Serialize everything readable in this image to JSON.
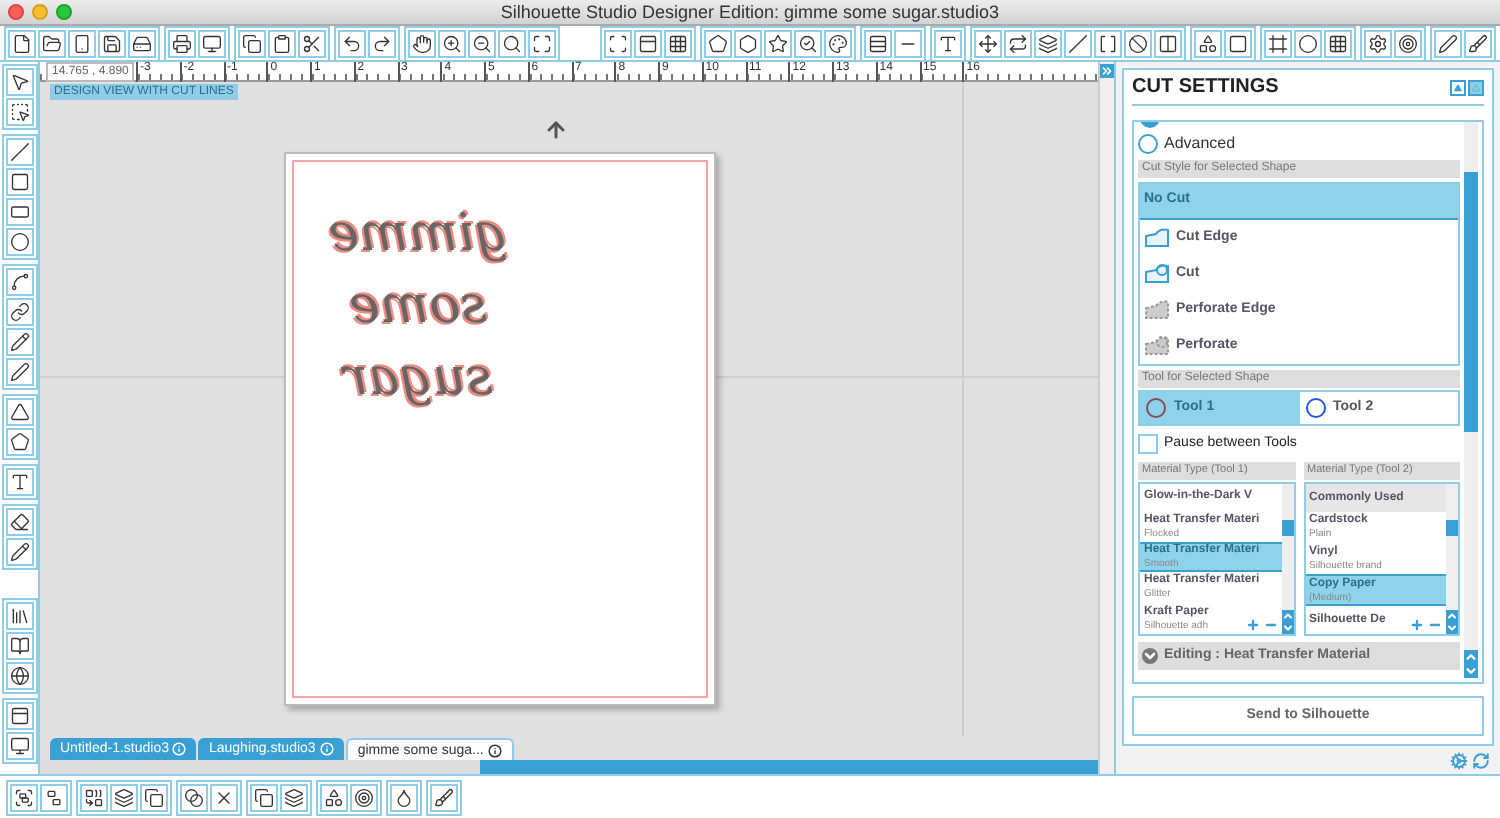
{
  "window": {
    "title": "Silhouette Studio Designer Edition: gimme some sugar.studio3"
  },
  "ruler": {
    "coordinates": "14.765 , 4.890",
    "labels": [
      "-3",
      "-2",
      "-1",
      "0",
      "1",
      "2",
      "3",
      "4",
      "5",
      "6",
      "7",
      "8",
      "9",
      "10",
      "11",
      "12",
      "13",
      "14",
      "15",
      "16"
    ]
  },
  "canvas": {
    "view_label": "DESIGN VIEW WITH CUT LINES",
    "design_text": "gimme some sugar"
  },
  "tabs": [
    {
      "label": "Untitled-1.studio3",
      "selected": false
    },
    {
      "label": "Laughing.studio3",
      "selected": false
    },
    {
      "label": "gimme some suga...",
      "selected": true
    }
  ],
  "cut_settings": {
    "title": "CUT SETTINGS",
    "mode": {
      "label": "Advanced",
      "selected": false
    },
    "cut_style_heading": "Cut Style for Selected Shape",
    "cut_styles": [
      {
        "label": "No Cut",
        "kind": "none",
        "selected": true
      },
      {
        "label": "Cut Edge",
        "kind": "edge",
        "selected": false
      },
      {
        "label": "Cut",
        "kind": "cut",
        "selected": false
      },
      {
        "label": "Perforate Edge",
        "kind": "perforate-edge",
        "selected": false
      },
      {
        "label": "Perforate",
        "kind": "perforate",
        "selected": false
      }
    ],
    "tool_heading": "Tool for Selected Shape",
    "tools": [
      {
        "label": "Tool 1",
        "selected": true,
        "color": "#8a4a5a"
      },
      {
        "label": "Tool 2",
        "selected": false,
        "color": "#2255ee"
      }
    ],
    "pause_between_tools": {
      "label": "Pause between Tools",
      "checked": false
    },
    "materials": [
      {
        "heading": "Material Type (Tool 1)",
        "items": [
          {
            "kind": "material",
            "name": "Glow-in-the-Dark V",
            "selected": false
          },
          {
            "kind": "material",
            "name": "Heat Transfer Materi",
            "detail": "Flocked",
            "selected": false
          },
          {
            "kind": "material",
            "name": "Heat Transfer Materi",
            "detail": "Smooth",
            "selected": true
          },
          {
            "kind": "material",
            "name": "Heat Transfer Materi",
            "detail": "Glitter",
            "selected": false
          },
          {
            "kind": "material",
            "name": "Kraft Paper",
            "detail": "Silhouette adh",
            "selected": false
          }
        ]
      },
      {
        "heading": "Material Type (Tool 2)",
        "items": [
          {
            "kind": "group",
            "name": "Commonly Used"
          },
          {
            "kind": "material",
            "name": "Cardstock",
            "detail": "Plain",
            "selected": false
          },
          {
            "kind": "material",
            "name": "Vinyl",
            "detail": "Silhouette brand",
            "selected": false
          },
          {
            "kind": "material",
            "name": "Copy Paper",
            "detail": "(Medium)",
            "selected": true
          },
          {
            "kind": "material",
            "name": "Silhouette De",
            "selected": false
          }
        ]
      }
    ],
    "editing": "Editing : Heat Transfer Material",
    "send_button": "Send to Silhouette"
  }
}
